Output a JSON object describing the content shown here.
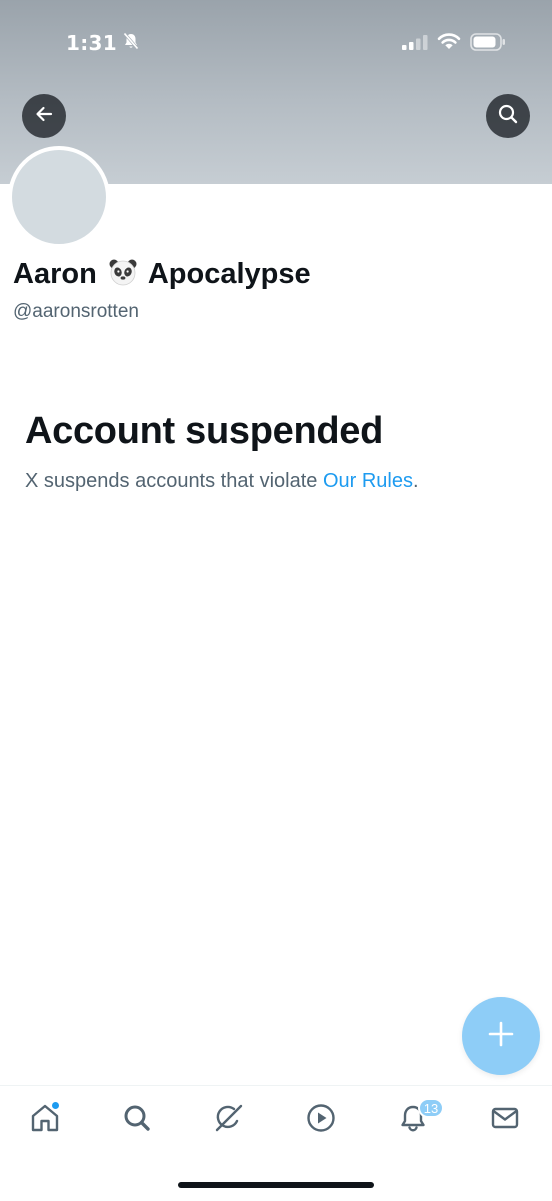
{
  "status_bar": {
    "time": "1:31"
  },
  "header": {
    "back_icon": "arrow-left-icon",
    "search_icon": "search-icon"
  },
  "profile": {
    "name_first": "Aaron",
    "name_emoji": "panda-face-emoji",
    "name_last": "Apocalypse",
    "handle": "@aaronsrotten"
  },
  "suspension": {
    "title": "Account suspended",
    "message": "X suspends accounts that violate ",
    "link_text": "Our Rules",
    "suffix": "."
  },
  "compose": {
    "icon": "plus-icon"
  },
  "tab_bar": {
    "items": [
      {
        "icon": "home-icon",
        "has_dot": true
      },
      {
        "icon": "search-icon"
      },
      {
        "icon": "grok-icon"
      },
      {
        "icon": "play-icon"
      },
      {
        "icon": "bell-icon",
        "badge": "13"
      },
      {
        "icon": "envelope-icon"
      }
    ]
  },
  "colors": {
    "accent": "#1d9bf0",
    "fab": "#8ecdf7",
    "text_primary": "#0f1419",
    "text_secondary": "#536471",
    "avatar_placeholder": "#d3dbe0"
  }
}
